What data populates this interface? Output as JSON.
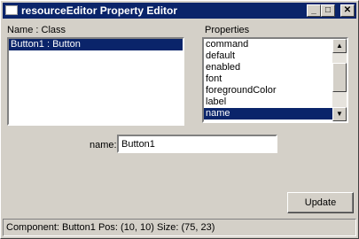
{
  "window": {
    "title": "resourceEditor Property Editor",
    "controls": {
      "minimize": "_",
      "maximize": "□",
      "close": "✕"
    }
  },
  "left_panel": {
    "header": "Name  :  Class",
    "items": [
      {
        "label": "Button1  :  Button",
        "selected": true
      }
    ]
  },
  "right_panel": {
    "header": "Properties",
    "items": [
      {
        "label": "command",
        "selected": false
      },
      {
        "label": "default",
        "selected": false
      },
      {
        "label": "enabled",
        "selected": false
      },
      {
        "label": "font",
        "selected": false
      },
      {
        "label": "foregroundColor",
        "selected": false
      },
      {
        "label": "label",
        "selected": false
      },
      {
        "label": "name",
        "selected": true
      }
    ],
    "scroll_up_icon": "▲",
    "scroll_down_icon": "▼"
  },
  "editor": {
    "field_label": "name:",
    "field_value": "Button1"
  },
  "actions": {
    "update_label": "Update"
  },
  "status": {
    "text": "Component: Button1  Pos: (10, 10)  Size: (75, 23)"
  },
  "colors": {
    "selection": "#0a246a",
    "face": "#d4d0c8"
  }
}
